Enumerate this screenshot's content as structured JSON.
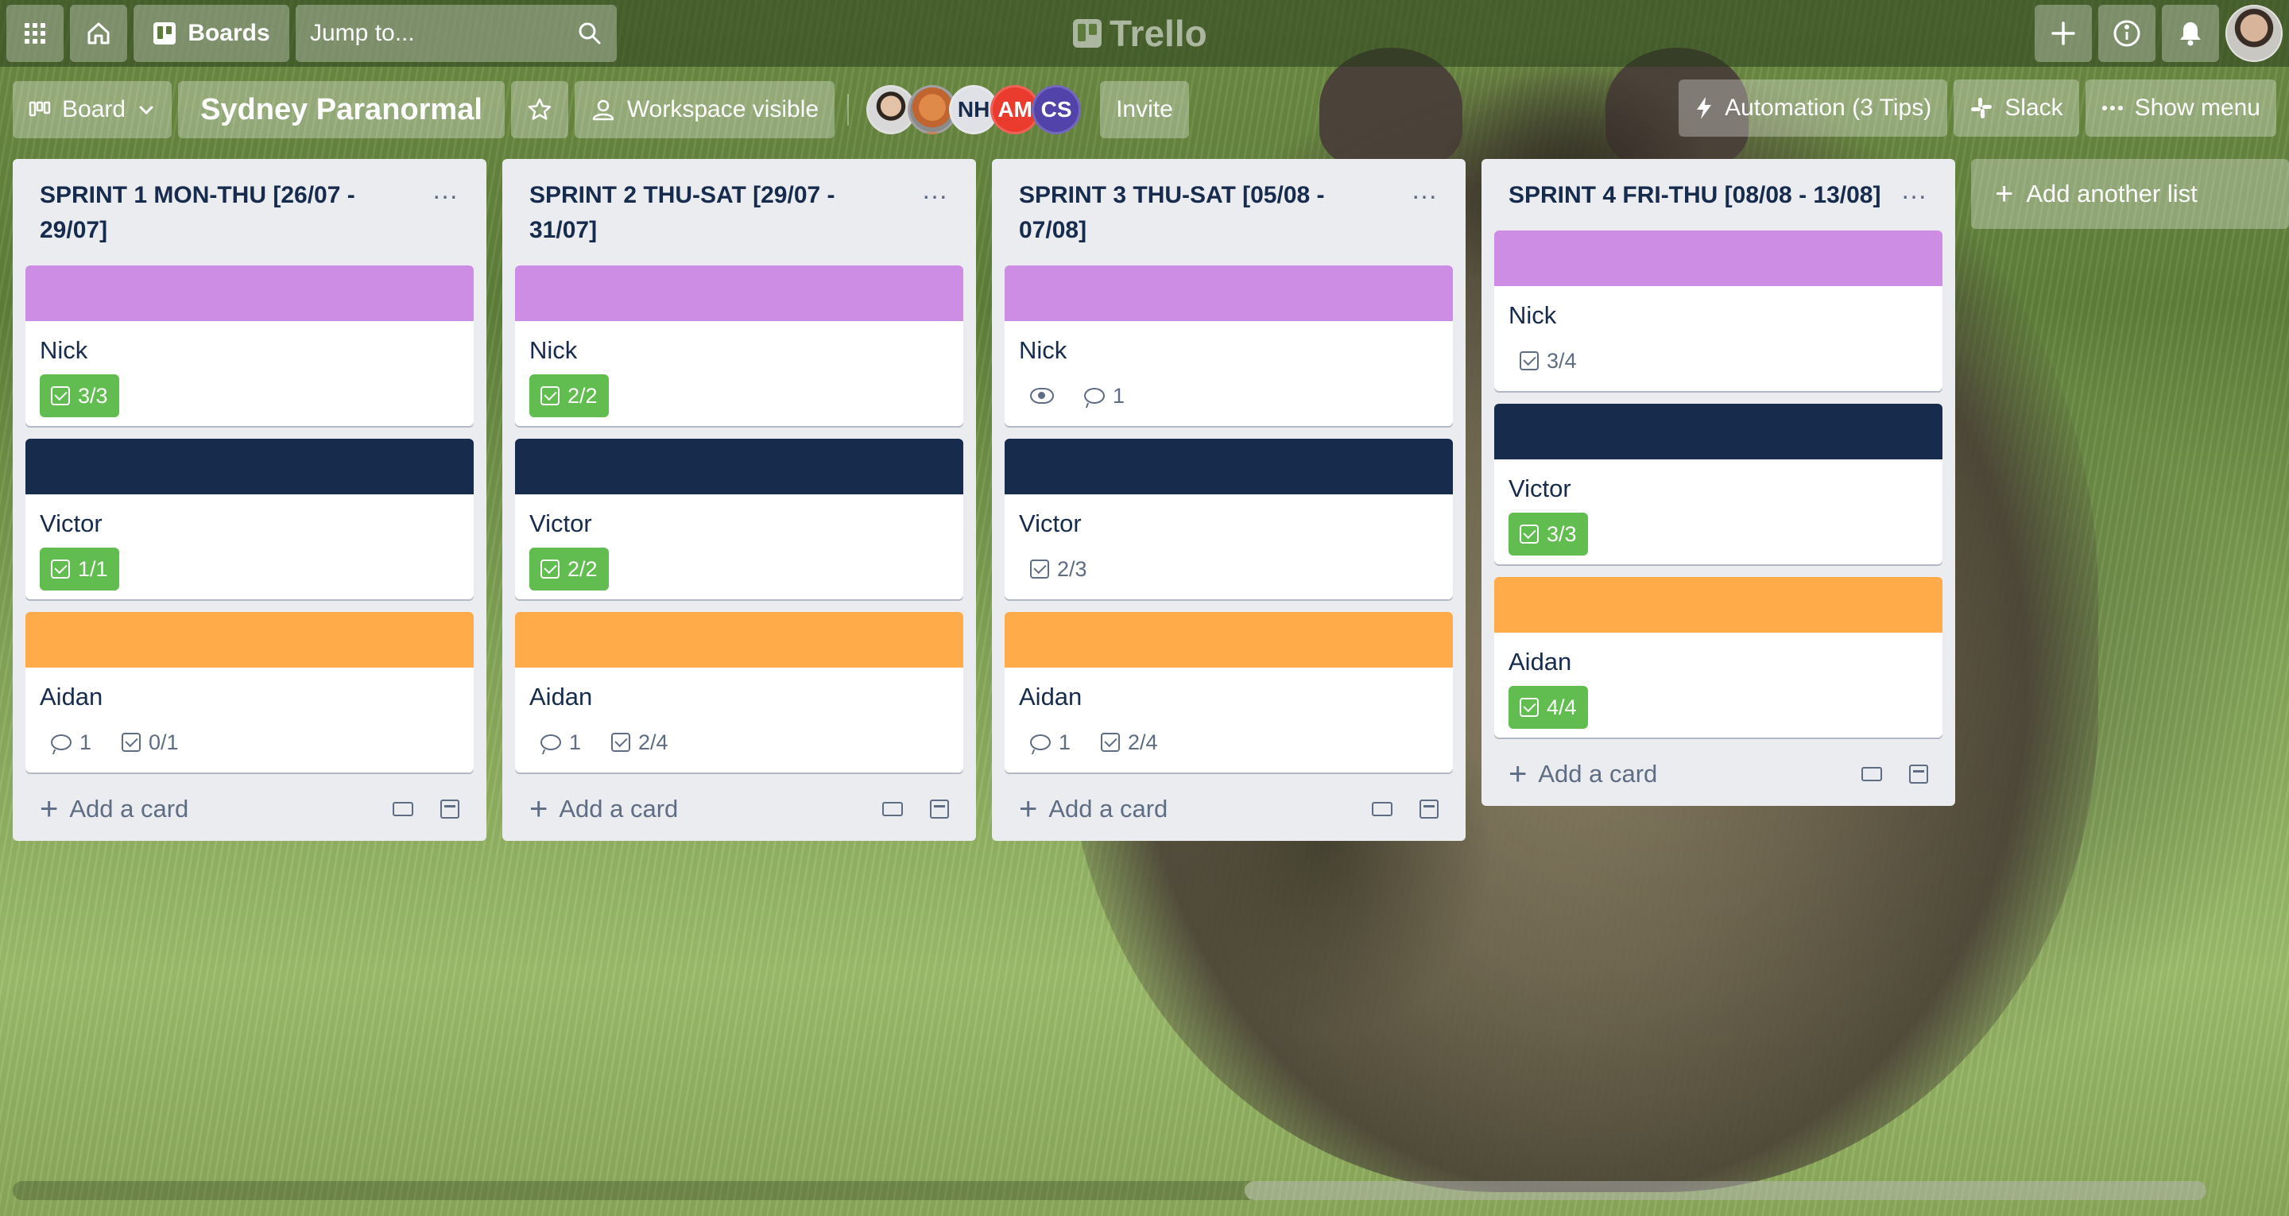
{
  "topbar": {
    "boards_label": "Boards",
    "search_placeholder": "Jump to...",
    "logo_text": "Trello"
  },
  "board": {
    "view_label": "Board",
    "title": "Sydney Paranormal",
    "visibility_label": "Workspace visible",
    "members": [
      {
        "initials": "",
        "type": "photo"
      },
      {
        "initials": "",
        "type": "photo"
      },
      {
        "initials": "NH",
        "color": "#dfe1e6"
      },
      {
        "initials": "AM",
        "color": "#eb3b2f"
      },
      {
        "initials": "CS",
        "color": "#5243aa"
      }
    ],
    "invite_label": "Invite",
    "automation_label": "Automation (3 Tips)",
    "slack_label": "Slack",
    "show_menu_label": "Show menu"
  },
  "colors": {
    "purple": "#cd8de5",
    "navy": "#172b4d",
    "orange": "#ffab4a",
    "complete_green": "#61bd4f"
  },
  "lists": [
    {
      "title": "SPRINT 1 MON-THU [26/07 - 29/07]",
      "cards": [
        {
          "cover": "purple",
          "title": "Nick",
          "badges": [
            {
              "type": "checklist",
              "text": "3/3",
              "complete": true
            }
          ]
        },
        {
          "cover": "navy",
          "title": "Victor",
          "badges": [
            {
              "type": "checklist",
              "text": "1/1",
              "complete": true
            }
          ]
        },
        {
          "cover": "orange",
          "title": "Aidan",
          "badges": [
            {
              "type": "comment",
              "text": "1"
            },
            {
              "type": "checklist",
              "text": "0/1",
              "complete": false
            }
          ]
        }
      ],
      "add_card_label": "Add a card"
    },
    {
      "title": "SPRINT 2  THU-SAT [29/07 - 31/07]",
      "cards": [
        {
          "cover": "purple",
          "title": "Nick",
          "badges": [
            {
              "type": "checklist",
              "text": "2/2",
              "complete": true
            }
          ]
        },
        {
          "cover": "navy",
          "title": "Victor",
          "badges": [
            {
              "type": "checklist",
              "text": "2/2",
              "complete": true
            }
          ]
        },
        {
          "cover": "orange",
          "title": "Aidan",
          "badges": [
            {
              "type": "comment",
              "text": "1"
            },
            {
              "type": "checklist",
              "text": "2/4",
              "complete": false
            }
          ]
        }
      ],
      "add_card_label": "Add a card"
    },
    {
      "title": "SPRINT 3 THU-SAT [05/08 - 07/08]",
      "cards": [
        {
          "cover": "purple",
          "title": "Nick",
          "badges": [
            {
              "type": "watch",
              "text": ""
            },
            {
              "type": "comment",
              "text": "1"
            }
          ]
        },
        {
          "cover": "navy",
          "title": "Victor",
          "badges": [
            {
              "type": "checklist",
              "text": "2/3",
              "complete": false
            }
          ]
        },
        {
          "cover": "orange",
          "title": "Aidan",
          "badges": [
            {
              "type": "comment",
              "text": "1"
            },
            {
              "type": "checklist",
              "text": "2/4",
              "complete": false
            }
          ]
        }
      ],
      "add_card_label": "Add a card"
    },
    {
      "title": "SPRINT 4 FRI-THU [08/08 - 13/08]",
      "cards": [
        {
          "cover": "purple",
          "title": "Nick",
          "badges": [
            {
              "type": "checklist",
              "text": "3/4",
              "complete": false
            }
          ]
        },
        {
          "cover": "navy",
          "title": "Victor",
          "badges": [
            {
              "type": "checklist",
              "text": "3/3",
              "complete": true
            }
          ]
        },
        {
          "cover": "orange",
          "title": "Aidan",
          "badges": [
            {
              "type": "checklist",
              "text": "4/4",
              "complete": true
            }
          ]
        }
      ],
      "add_card_label": "Add a card"
    }
  ],
  "add_list_label": "Add another list",
  "icons": [
    "apps-grid-icon",
    "home-icon",
    "boards-icon",
    "search-icon",
    "plus-icon",
    "info-icon",
    "bell-icon",
    "star-icon",
    "people-icon",
    "bolt-icon",
    "slack-icon",
    "more-icon"
  ]
}
